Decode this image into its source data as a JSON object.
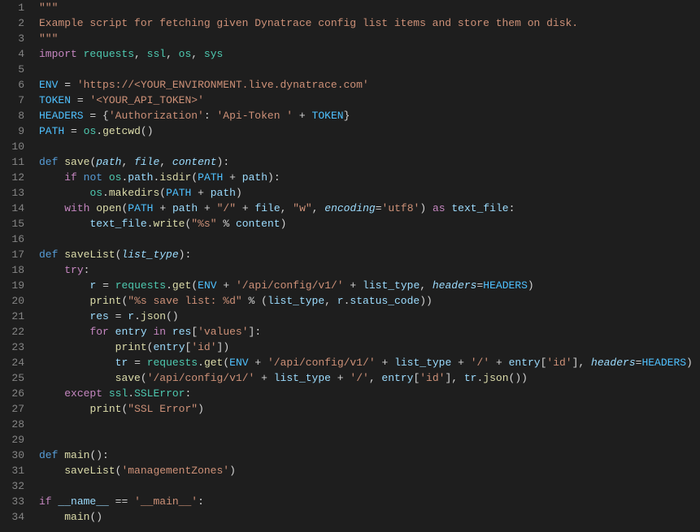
{
  "lineCount": 34,
  "code": {
    "l1": [
      {
        "c": "tok-str",
        "t": "\"\"\""
      }
    ],
    "l2": [
      {
        "c": "tok-str",
        "t": "Example script for fetching given Dynatrace config list items and store them on disk."
      }
    ],
    "l3": [
      {
        "c": "tok-str",
        "t": "\"\"\""
      }
    ],
    "l4": [
      {
        "c": "tok-ctrl",
        "t": "import"
      },
      {
        "t": " "
      },
      {
        "c": "tok-cls",
        "t": "requests"
      },
      {
        "t": ", "
      },
      {
        "c": "tok-cls",
        "t": "ssl"
      },
      {
        "t": ", "
      },
      {
        "c": "tok-cls",
        "t": "os"
      },
      {
        "t": ", "
      },
      {
        "c": "tok-cls",
        "t": "sys"
      }
    ],
    "l5": [],
    "l6": [
      {
        "c": "tok-const",
        "t": "ENV"
      },
      {
        "t": " "
      },
      {
        "c": "tok-op",
        "t": "="
      },
      {
        "t": " "
      },
      {
        "c": "tok-str",
        "t": "'https://<YOUR_ENVIRONMENT.live.dynatrace.com'"
      }
    ],
    "l7": [
      {
        "c": "tok-const",
        "t": "TOKEN"
      },
      {
        "t": " "
      },
      {
        "c": "tok-op",
        "t": "="
      },
      {
        "t": " "
      },
      {
        "c": "tok-str",
        "t": "'<YOUR_API_TOKEN>'"
      }
    ],
    "l8": [
      {
        "c": "tok-const",
        "t": "HEADERS"
      },
      {
        "t": " "
      },
      {
        "c": "tok-op",
        "t": "="
      },
      {
        "t": " {"
      },
      {
        "c": "tok-str",
        "t": "'Authorization'"
      },
      {
        "t": ": "
      },
      {
        "c": "tok-str",
        "t": "'Api-Token '"
      },
      {
        "t": " "
      },
      {
        "c": "tok-op",
        "t": "+"
      },
      {
        "t": " "
      },
      {
        "c": "tok-const",
        "t": "TOKEN"
      },
      {
        "t": "}"
      }
    ],
    "l9": [
      {
        "c": "tok-const",
        "t": "PATH"
      },
      {
        "t": " "
      },
      {
        "c": "tok-op",
        "t": "="
      },
      {
        "t": " "
      },
      {
        "c": "tok-cls",
        "t": "os"
      },
      {
        "t": "."
      },
      {
        "c": "tok-fn",
        "t": "getcwd"
      },
      {
        "t": "()"
      }
    ],
    "l10": [],
    "l11": [
      {
        "c": "tok-kw",
        "t": "def"
      },
      {
        "t": " "
      },
      {
        "c": "tok-fn",
        "t": "save"
      },
      {
        "t": "("
      },
      {
        "c": "tok-param",
        "t": "path"
      },
      {
        "t": ", "
      },
      {
        "c": "tok-param",
        "t": "file"
      },
      {
        "t": ", "
      },
      {
        "c": "tok-param",
        "t": "content"
      },
      {
        "t": "):"
      }
    ],
    "l12": [
      {
        "c": "tok-ctrl",
        "t": "if"
      },
      {
        "t": " "
      },
      {
        "c": "tok-kw",
        "t": "not"
      },
      {
        "t": " "
      },
      {
        "c": "tok-cls",
        "t": "os"
      },
      {
        "t": "."
      },
      {
        "c": "tok-var",
        "t": "path"
      },
      {
        "t": "."
      },
      {
        "c": "tok-fn",
        "t": "isdir"
      },
      {
        "t": "("
      },
      {
        "c": "tok-const",
        "t": "PATH"
      },
      {
        "t": " "
      },
      {
        "c": "tok-op",
        "t": "+"
      },
      {
        "t": " "
      },
      {
        "c": "tok-var",
        "t": "path"
      },
      {
        "t": "):"
      }
    ],
    "l13": [
      {
        "c": "tok-cls",
        "t": "os"
      },
      {
        "t": "."
      },
      {
        "c": "tok-fn",
        "t": "makedirs"
      },
      {
        "t": "("
      },
      {
        "c": "tok-const",
        "t": "PATH"
      },
      {
        "t": " "
      },
      {
        "c": "tok-op",
        "t": "+"
      },
      {
        "t": " "
      },
      {
        "c": "tok-var",
        "t": "path"
      },
      {
        "t": ")"
      }
    ],
    "l14": [
      {
        "c": "tok-ctrl",
        "t": "with"
      },
      {
        "t": " "
      },
      {
        "c": "tok-fn",
        "t": "open"
      },
      {
        "t": "("
      },
      {
        "c": "tok-const",
        "t": "PATH"
      },
      {
        "t": " "
      },
      {
        "c": "tok-op",
        "t": "+"
      },
      {
        "t": " "
      },
      {
        "c": "tok-var",
        "t": "path"
      },
      {
        "t": " "
      },
      {
        "c": "tok-op",
        "t": "+"
      },
      {
        "t": " "
      },
      {
        "c": "tok-str",
        "t": "\"/\""
      },
      {
        "t": " "
      },
      {
        "c": "tok-op",
        "t": "+"
      },
      {
        "t": " "
      },
      {
        "c": "tok-var",
        "t": "file"
      },
      {
        "t": ", "
      },
      {
        "c": "tok-str",
        "t": "\"w\""
      },
      {
        "t": ", "
      },
      {
        "c": "tok-kwarg",
        "t": "encoding"
      },
      {
        "c": "tok-op",
        "t": "="
      },
      {
        "c": "tok-str",
        "t": "'utf8'"
      },
      {
        "t": ") "
      },
      {
        "c": "tok-ctrl",
        "t": "as"
      },
      {
        "t": " "
      },
      {
        "c": "tok-var",
        "t": "text_file"
      },
      {
        "t": ":"
      }
    ],
    "l15": [
      {
        "c": "tok-var",
        "t": "text_file"
      },
      {
        "t": "."
      },
      {
        "c": "tok-fn",
        "t": "write"
      },
      {
        "t": "("
      },
      {
        "c": "tok-str",
        "t": "\"%s\""
      },
      {
        "t": " "
      },
      {
        "c": "tok-op",
        "t": "%"
      },
      {
        "t": " "
      },
      {
        "c": "tok-var",
        "t": "content"
      },
      {
        "t": ")"
      }
    ],
    "l16": [],
    "l17": [
      {
        "c": "tok-kw",
        "t": "def"
      },
      {
        "t": " "
      },
      {
        "c": "tok-fn",
        "t": "saveList"
      },
      {
        "t": "("
      },
      {
        "c": "tok-param",
        "t": "list_type"
      },
      {
        "t": "):"
      }
    ],
    "l18": [
      {
        "c": "tok-ctrl",
        "t": "try"
      },
      {
        "t": ":"
      }
    ],
    "l19": [
      {
        "c": "tok-var",
        "t": "r"
      },
      {
        "t": " "
      },
      {
        "c": "tok-op",
        "t": "="
      },
      {
        "t": " "
      },
      {
        "c": "tok-cls",
        "t": "requests"
      },
      {
        "t": "."
      },
      {
        "c": "tok-fn",
        "t": "get"
      },
      {
        "t": "("
      },
      {
        "c": "tok-const",
        "t": "ENV"
      },
      {
        "t": " "
      },
      {
        "c": "tok-op",
        "t": "+"
      },
      {
        "t": " "
      },
      {
        "c": "tok-str",
        "t": "'/api/config/v1/'"
      },
      {
        "t": " "
      },
      {
        "c": "tok-op",
        "t": "+"
      },
      {
        "t": " "
      },
      {
        "c": "tok-var",
        "t": "list_type"
      },
      {
        "t": ", "
      },
      {
        "c": "tok-kwarg",
        "t": "headers"
      },
      {
        "c": "tok-op",
        "t": "="
      },
      {
        "c": "tok-const",
        "t": "HEADERS"
      },
      {
        "t": ")"
      }
    ],
    "l20": [
      {
        "c": "tok-fn",
        "t": "print"
      },
      {
        "t": "("
      },
      {
        "c": "tok-str",
        "t": "\"%s save list: %d\""
      },
      {
        "t": " "
      },
      {
        "c": "tok-op",
        "t": "%"
      },
      {
        "t": " ("
      },
      {
        "c": "tok-var",
        "t": "list_type"
      },
      {
        "t": ", "
      },
      {
        "c": "tok-var",
        "t": "r"
      },
      {
        "t": "."
      },
      {
        "c": "tok-var",
        "t": "status_code"
      },
      {
        "t": "))"
      }
    ],
    "l21": [
      {
        "c": "tok-var",
        "t": "res"
      },
      {
        "t": " "
      },
      {
        "c": "tok-op",
        "t": "="
      },
      {
        "t": " "
      },
      {
        "c": "tok-var",
        "t": "r"
      },
      {
        "t": "."
      },
      {
        "c": "tok-fn",
        "t": "json"
      },
      {
        "t": "()"
      }
    ],
    "l22": [
      {
        "c": "tok-ctrl",
        "t": "for"
      },
      {
        "t": " "
      },
      {
        "c": "tok-var",
        "t": "entry"
      },
      {
        "t": " "
      },
      {
        "c": "tok-ctrl",
        "t": "in"
      },
      {
        "t": " "
      },
      {
        "c": "tok-var",
        "t": "res"
      },
      {
        "t": "["
      },
      {
        "c": "tok-str",
        "t": "'values'"
      },
      {
        "t": "]:"
      }
    ],
    "l23": [
      {
        "c": "tok-fn",
        "t": "print"
      },
      {
        "t": "("
      },
      {
        "c": "tok-var",
        "t": "entry"
      },
      {
        "t": "["
      },
      {
        "c": "tok-str",
        "t": "'id'"
      },
      {
        "t": "])"
      }
    ],
    "l24": [
      {
        "c": "tok-var",
        "t": "tr"
      },
      {
        "t": " "
      },
      {
        "c": "tok-op",
        "t": "="
      },
      {
        "t": " "
      },
      {
        "c": "tok-cls",
        "t": "requests"
      },
      {
        "t": "."
      },
      {
        "c": "tok-fn",
        "t": "get"
      },
      {
        "t": "("
      },
      {
        "c": "tok-const",
        "t": "ENV"
      },
      {
        "t": " "
      },
      {
        "c": "tok-op",
        "t": "+"
      },
      {
        "t": " "
      },
      {
        "c": "tok-str",
        "t": "'/api/config/v1/'"
      },
      {
        "t": " "
      },
      {
        "c": "tok-op",
        "t": "+"
      },
      {
        "t": " "
      },
      {
        "c": "tok-var",
        "t": "list_type"
      },
      {
        "t": " "
      },
      {
        "c": "tok-op",
        "t": "+"
      },
      {
        "t": " "
      },
      {
        "c": "tok-str",
        "t": "'/'"
      },
      {
        "t": " "
      },
      {
        "c": "tok-op",
        "t": "+"
      },
      {
        "t": " "
      },
      {
        "c": "tok-var",
        "t": "entry"
      },
      {
        "t": "["
      },
      {
        "c": "tok-str",
        "t": "'id'"
      },
      {
        "t": "], "
      },
      {
        "c": "tok-kwarg",
        "t": "headers"
      },
      {
        "c": "tok-op",
        "t": "="
      },
      {
        "c": "tok-const",
        "t": "HEADERS"
      },
      {
        "t": ")"
      }
    ],
    "l25": [
      {
        "c": "tok-fn",
        "t": "save"
      },
      {
        "t": "("
      },
      {
        "c": "tok-str",
        "t": "'/api/config/v1/'"
      },
      {
        "t": " "
      },
      {
        "c": "tok-op",
        "t": "+"
      },
      {
        "t": " "
      },
      {
        "c": "tok-var",
        "t": "list_type"
      },
      {
        "t": " "
      },
      {
        "c": "tok-op",
        "t": "+"
      },
      {
        "t": " "
      },
      {
        "c": "tok-str",
        "t": "'/'"
      },
      {
        "t": ", "
      },
      {
        "c": "tok-var",
        "t": "entry"
      },
      {
        "t": "["
      },
      {
        "c": "tok-str",
        "t": "'id'"
      },
      {
        "t": "], "
      },
      {
        "c": "tok-var",
        "t": "tr"
      },
      {
        "t": "."
      },
      {
        "c": "tok-fn",
        "t": "json"
      },
      {
        "t": "())"
      }
    ],
    "l26": [
      {
        "c": "tok-ctrl",
        "t": "except"
      },
      {
        "t": " "
      },
      {
        "c": "tok-cls",
        "t": "ssl"
      },
      {
        "t": "."
      },
      {
        "c": "tok-cls",
        "t": "SSLError"
      },
      {
        "t": ":"
      }
    ],
    "l27": [
      {
        "c": "tok-fn",
        "t": "print"
      },
      {
        "t": "("
      },
      {
        "c": "tok-str",
        "t": "\"SSL Error\""
      },
      {
        "t": ")"
      }
    ],
    "l28": [],
    "l29": [],
    "l30": [
      {
        "c": "tok-kw",
        "t": "def"
      },
      {
        "t": " "
      },
      {
        "c": "tok-fn",
        "t": "main"
      },
      {
        "t": "():"
      }
    ],
    "l31": [
      {
        "c": "tok-fn",
        "t": "saveList"
      },
      {
        "t": "("
      },
      {
        "c": "tok-str",
        "t": "'managementZones'"
      },
      {
        "t": ")"
      }
    ],
    "l32": [],
    "l33": [
      {
        "c": "tok-ctrl",
        "t": "if"
      },
      {
        "t": " "
      },
      {
        "c": "tok-var",
        "t": "__name__"
      },
      {
        "t": " "
      },
      {
        "c": "tok-op",
        "t": "=="
      },
      {
        "t": " "
      },
      {
        "c": "tok-str",
        "t": "'__main__'"
      },
      {
        "t": ":"
      }
    ],
    "l34": [
      {
        "c": "tok-fn",
        "t": "main"
      },
      {
        "t": "()"
      }
    ]
  },
  "indent": {
    "l1": 0,
    "l2": 0,
    "l3": 0,
    "l4": 0,
    "l5": 0,
    "l6": 0,
    "l7": 0,
    "l8": 0,
    "l9": 0,
    "l10": 0,
    "l11": 0,
    "l12": 1,
    "l13": 2,
    "l14": 1,
    "l15": 2,
    "l16": 0,
    "l17": 0,
    "l18": 1,
    "l19": 2,
    "l20": 2,
    "l21": 2,
    "l22": 2,
    "l23": 3,
    "l24": 3,
    "l25": 3,
    "l26": 1,
    "l27": 2,
    "l28": 0,
    "l29": 0,
    "l30": 0,
    "l31": 1,
    "l32": 0,
    "l33": 0,
    "l34": 1
  }
}
